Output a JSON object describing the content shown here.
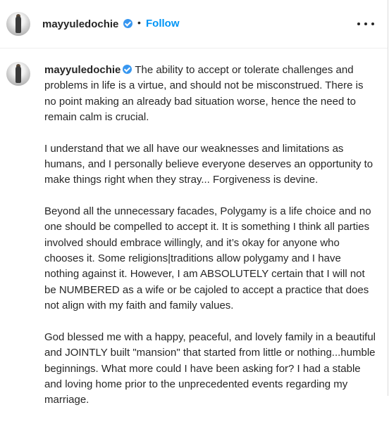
{
  "post_header": {
    "username": "mayyuledochie",
    "separator": "•",
    "follow_label": "Follow",
    "more_icon": "more-horizontal-icon"
  },
  "caption": {
    "username": "mayyuledochie",
    "paragraphs": [
      "The ability to accept or tolerate challenges and problems in life is a virtue, and should not be misconstrued. There is no point making an already bad situation worse, hence the need to remain calm is crucial.",
      "I understand that we all have our weaknesses and limitations as humans, and I personally believe everyone deserves an opportunity to make things right when they stray... Forgiveness is devine.",
      "Beyond all the unnecessary facades, Polygamy is a life choice and no one should be compelled to accept it. It is something I think all parties involved should embrace willingly, and it’s okay for anyone who chooses it. Some religions|traditions allow polygamy and I have nothing against it. However, I am ABSOLUTELY certain that I will not be NUMBERED as a wife or be cajoled to accept a practice that does not align with my faith and family values.",
      "God blessed me with a happy, peaceful, and lovely family in a beautiful and JOINTLY built \"mansion\" that started from little or nothing...humble beginnings. What more could I have been asking for? I had a stable and loving home prior to the unprecedented events regarding my marriage."
    ]
  },
  "colors": {
    "follow": "#0095f6",
    "verified": "#3897f0",
    "text": "#262626"
  }
}
